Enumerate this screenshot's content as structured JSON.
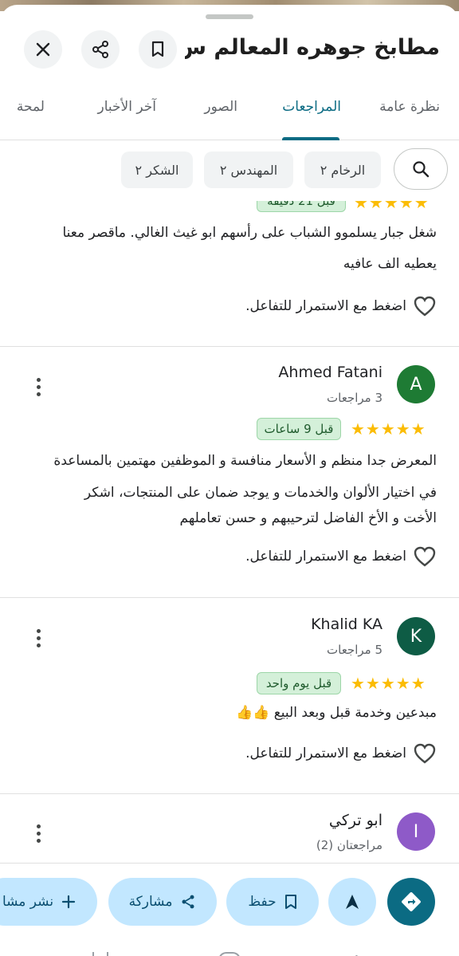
{
  "header": {
    "title": "مطابخ جوهره المعالم س..."
  },
  "tabs": [
    {
      "label": "نظرة عامة"
    },
    {
      "label": "المراجعات"
    },
    {
      "label": "الصور"
    },
    {
      "label": "آخر الأخبار"
    },
    {
      "label": "لمحة"
    }
  ],
  "chips": [
    {
      "label": "الرخام ٢"
    },
    {
      "label": "المهندس ٢"
    },
    {
      "label": "الشكر ٢"
    }
  ],
  "partial_review": {
    "badge": "قبل 21 دقيقة",
    "text_line1": "شغل جبار يسلموو الشباب على رأسهم ابو غيث الغالي. ماقصر معنا",
    "text_line2": "يعطيه الف عافيه",
    "like_label": "اضغط مع الاستمرار للتفاعل."
  },
  "reviews": [
    {
      "initial": "A",
      "name": "Ahmed Fatani",
      "meta": "3 مراجعات",
      "rating": 5,
      "time": "قبل 9 ساعات",
      "lines": [
        "المعرض جدا منظم و الأسعار منافسة و الموظفين مهتمين بالمساعدة",
        "في اختيار الألوان والخدمات  و يوجد ضمان على المنتجات، اشكر",
        "الأخت و الأخ الفاضل لترحيبهم و حسن تعاملهم"
      ],
      "like_label": "اضغط مع الاستمرار للتفاعل.",
      "avatar_color": "#1e7b34"
    },
    {
      "initial": "K",
      "name": "Khalid KA",
      "meta": "5 مراجعات",
      "rating": 5,
      "time": "قبل يوم واحد",
      "lines": [
        "مبدعين وخدمة قبل وبعد البيع 👍👍"
      ],
      "like_label": "اضغط مع الاستمرار للتفاعل.",
      "avatar_color": "#0e5c45"
    },
    {
      "initial": "I",
      "name": "ابو تركي",
      "meta": "مراجعتان (2)",
      "avatar_color": "#8e5ac8"
    }
  ],
  "actions": {
    "save": "حفظ",
    "share": "مشاركة",
    "post": "نشر مشا"
  },
  "colors": {
    "accent": "#0b6b83",
    "chip_bg": "#f1f3f4",
    "action_pill": "#c2e7ff",
    "star": "#fbbc04",
    "badge_bg": "#d4f0d9"
  },
  "icons": [
    "close-icon",
    "share-icon",
    "bookmark-icon",
    "search-icon",
    "heart-icon",
    "more-vert-icon",
    "directions-icon",
    "navigation-arrow-icon",
    "plus-icon"
  ]
}
